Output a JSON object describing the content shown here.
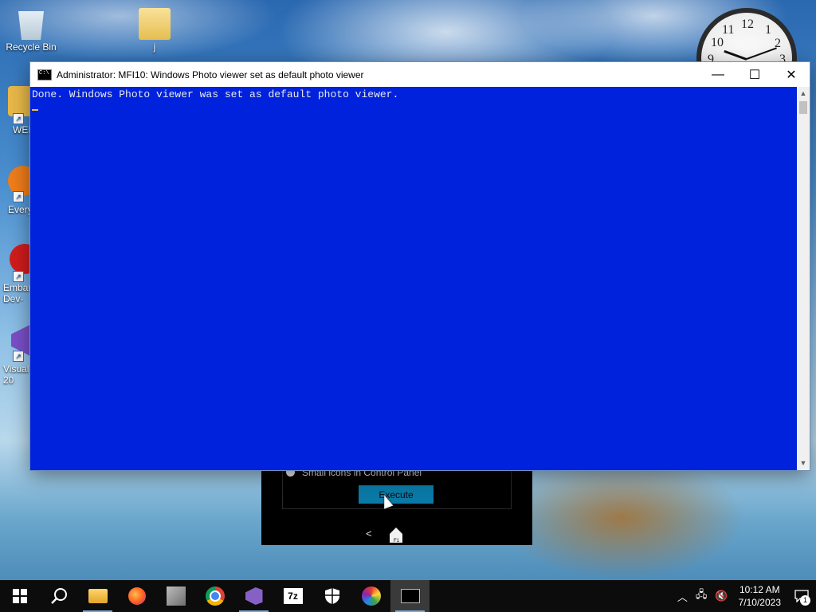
{
  "desktop": {
    "icons": [
      {
        "label": "Recycle Bin"
      },
      {
        "label": "j"
      },
      {
        "label": "WEI"
      },
      {
        "label": "Every"
      },
      {
        "label": "Embar Dev-"
      },
      {
        "label": "Visual 20"
      }
    ]
  },
  "clock_gadget": {
    "numbers": [
      "12",
      "11",
      "1",
      "10",
      "2",
      "9",
      "3"
    ]
  },
  "console_window": {
    "title": "Administrator:  MFI10: Windows Photo viewer set as default photo viewer",
    "output_line": "Done. Windows Photo viewer was set as default photo viewer.",
    "background_color": "#0022dd",
    "text_color": "#e8e8e8",
    "controls": {
      "minimize": "—",
      "maximize": "☐",
      "close": "✕"
    }
  },
  "background_app": {
    "radio_label": "Small icons in Control Panel",
    "execute_label": "Execute",
    "back_label": "<",
    "home_badge": "F1"
  },
  "taskbar": {
    "apps": [
      {
        "icon": "start-icon"
      },
      {
        "icon": "search-icon"
      },
      {
        "icon": "file-explorer-icon"
      },
      {
        "icon": "firefox-icon"
      },
      {
        "icon": "app-icon"
      },
      {
        "icon": "chrome-icon"
      },
      {
        "icon": "visual-studio-icon"
      },
      {
        "icon": "7zip-icon",
        "label": "7z"
      },
      {
        "icon": "security-icon"
      },
      {
        "icon": "color-wheel-icon"
      },
      {
        "icon": "command-prompt-icon"
      }
    ],
    "time": "10:12 AM",
    "date": "7/10/2023",
    "notification_count": "1"
  }
}
